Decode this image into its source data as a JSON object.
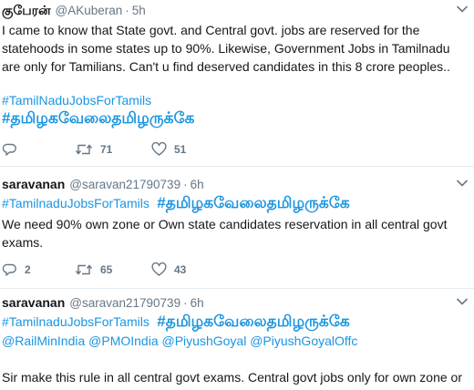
{
  "tweets": [
    {
      "name": "குபேரன்",
      "handle": "@AKuberan",
      "separator": "·",
      "time": "5h",
      "lines": [
        "I came to know that State govt. and Central govt. jobs are reserved for the",
        "statehoods in some states up to 90%. Likewise, Government Jobs in Tamilnadu",
        "are only for Tamilians. Can't u find deserved candidates in this 8 crore peoples.."
      ],
      "hashtag_en": "#TamilNaduJobsForTamils",
      "hashtag_ta": "#தமிழகவேலைதமிழருக்கே",
      "retweets": "71",
      "likes": "51"
    },
    {
      "name": "saravanan",
      "handle": "@saravan21790739",
      "separator": "·",
      "time": "6h",
      "hashtag_en": "#TamilnaduJobsForTamils",
      "hashtag_ta": "#தமிழகவேலைதமிழருக்கே",
      "lines": [
        "We need 90% own zone or Own state candidates reservation in all central govt",
        "exams."
      ],
      "replies": "2",
      "retweets": "65",
      "likes": "43"
    },
    {
      "name": "saravanan",
      "handle": "@saravan21790739",
      "separator": "·",
      "time": "6h",
      "hashtag_en": "#TamilnaduJobsForTamils",
      "hashtag_ta": "#தமிழகவேலைதமிழருக்கே",
      "mentions": [
        "@RailMinIndia",
        "@PMOIndia",
        "@PiyushGoyal",
        "@PiyushGoyalOffc"
      ],
      "lines": [
        "Sir make this rule in all central govt exams. Central govt jobs only for own zone or"
      ]
    }
  ],
  "icons": {
    "reply": "reply-icon",
    "retweet": "retweet-icon",
    "like": "heart-icon",
    "more": "chevron-down-icon"
  },
  "colors": {
    "link": "#1b95e0",
    "text": "#14171a",
    "muted": "#657786",
    "divider": "#e6ecf0"
  }
}
